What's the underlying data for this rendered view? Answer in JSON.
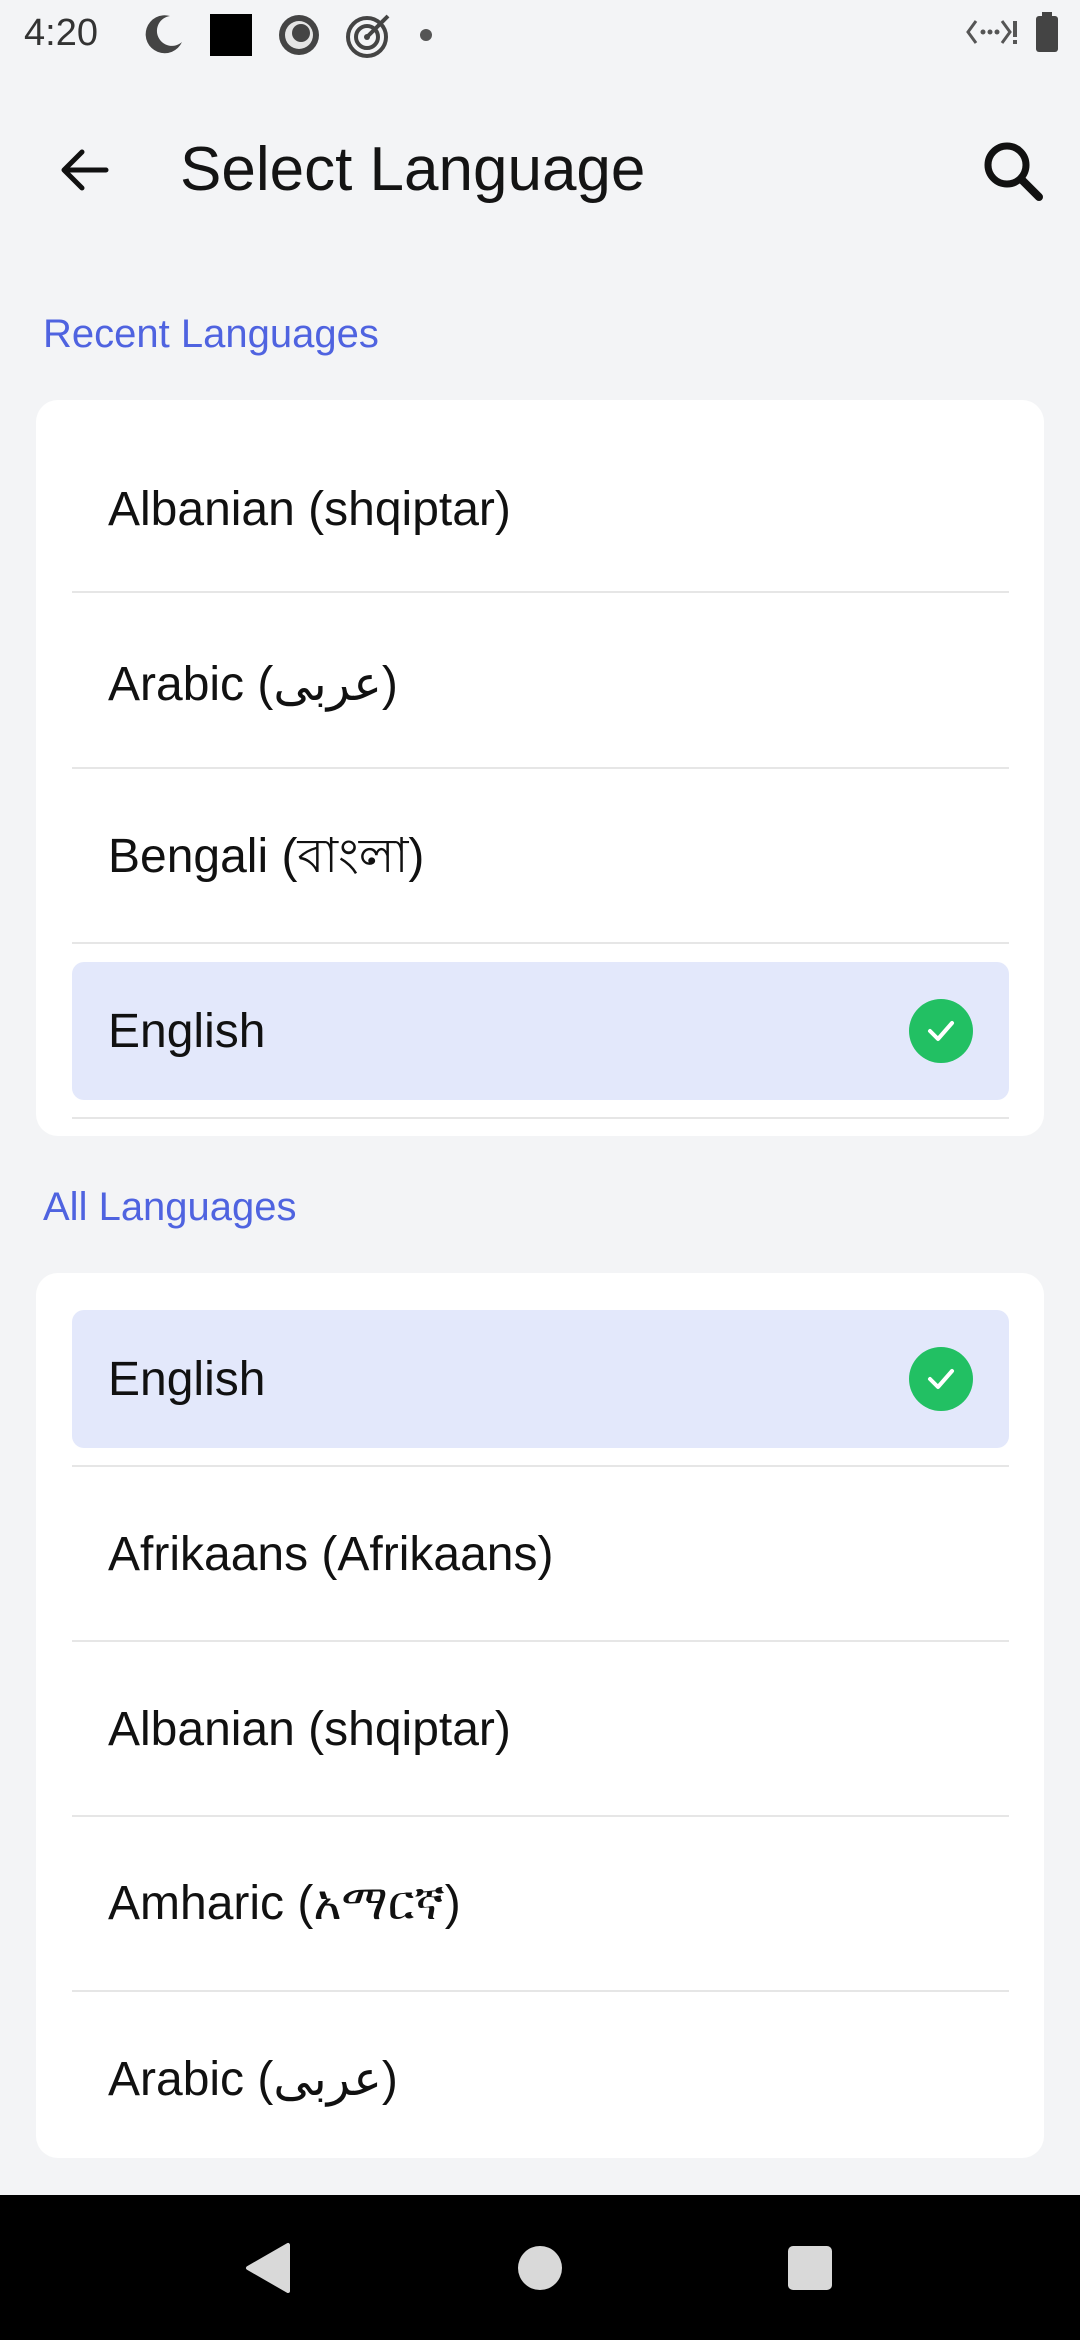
{
  "status_bar": {
    "time": "4:20",
    "left_icons": [
      "moon-clock-icon",
      "black-square-icon",
      "record-icon",
      "target-icon",
      "dot-icon"
    ],
    "right_icons": [
      "data-saver-icon",
      "battery-icon"
    ]
  },
  "header": {
    "title": "Select Language",
    "back_icon": "arrow-left-icon",
    "search_icon": "search-icon"
  },
  "recent": {
    "title": "Recent Languages",
    "items": [
      {
        "label": "Albanian (shqiptar)",
        "selected": false
      },
      {
        "label": "Arabic (عربى)",
        "selected": false
      },
      {
        "label": "Bengali (বাংলা)",
        "selected": false
      },
      {
        "label": "English",
        "selected": true
      }
    ]
  },
  "all": {
    "title": "All Languages",
    "items": [
      {
        "label": "English",
        "selected": true
      },
      {
        "label": "Afrikaans (Afrikaans)",
        "selected": false
      },
      {
        "label": "Albanian (shqiptar)",
        "selected": false
      },
      {
        "label": "Amharic (አማርኛ)",
        "selected": false
      },
      {
        "label": "Arabic (عربى)",
        "selected": false
      }
    ]
  },
  "colors": {
    "accent": "#4f63e0",
    "selected_bg": "#e3e8fb",
    "check": "#22c063",
    "background": "#f3f4f6"
  },
  "nav": {
    "icons": [
      "back-triangle-icon",
      "home-circle-icon",
      "recents-square-icon"
    ]
  }
}
